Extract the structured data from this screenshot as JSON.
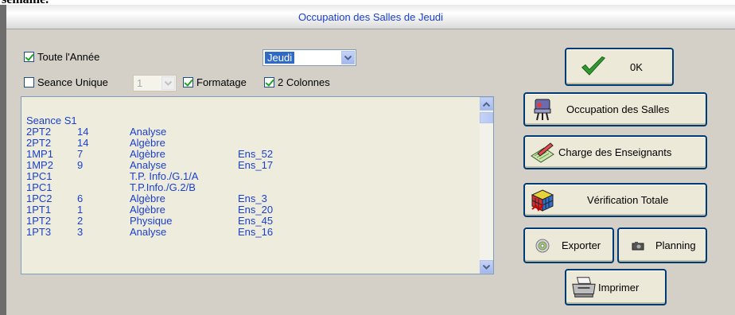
{
  "top_cut_text": "semaine.",
  "window": {
    "title": "Occupation des Salles de  Jeudi"
  },
  "options": {
    "toute_annee": {
      "label": "Toute l'Année",
      "checked": true
    },
    "seance_unique": {
      "label": "Seance Unique",
      "checked": false,
      "value": "1"
    },
    "formatage": {
      "label": "Formatage",
      "checked": true
    },
    "deux_colonnes": {
      "label": "2 Colonnes",
      "checked": true
    },
    "day": {
      "selected": "Jeudi"
    }
  },
  "list": {
    "heading": "Seance S1",
    "rows": [
      [
        "2PT2",
        "14",
        "Analyse",
        ""
      ],
      [
        "2PT2",
        "14",
        "Algèbre",
        ""
      ],
      [
        "1MP1",
        "7",
        "Algèbre",
        "Ens_52"
      ],
      [
        "1MP2",
        "9",
        "Analyse",
        "Ens_17"
      ],
      [
        "1PC1",
        "",
        "T.P. Info./G.1/A",
        ""
      ],
      [
        "1PC1",
        "",
        "T.P.Info./G.2/B",
        ""
      ],
      [
        "1PC2",
        "6",
        "Algèbre",
        "Ens_3"
      ],
      [
        "1PT1",
        "1",
        "Algèbre",
        "Ens_20"
      ],
      [
        "1PT2",
        "2",
        "Physique",
        "Ens_45"
      ],
      [
        "1PT3",
        "3",
        "Analyse",
        "Ens_16"
      ]
    ]
  },
  "buttons": {
    "ok": "0K",
    "occupation": "Occupation des Salles",
    "charge": "Charge des Enseignants",
    "verification": "Vérification Totale",
    "exporter": "Exporter",
    "planning": "Planning",
    "imprimer": "Imprimer"
  },
  "icons": {
    "ok": "checkmark-icon",
    "occupation": "office-chair-icon",
    "charge": "pen-notebook-icon",
    "verification": "rubik-cube-icon",
    "exporter": "cd-disc-icon",
    "planning": "camera-icon",
    "imprimer": "printer-icon"
  }
}
